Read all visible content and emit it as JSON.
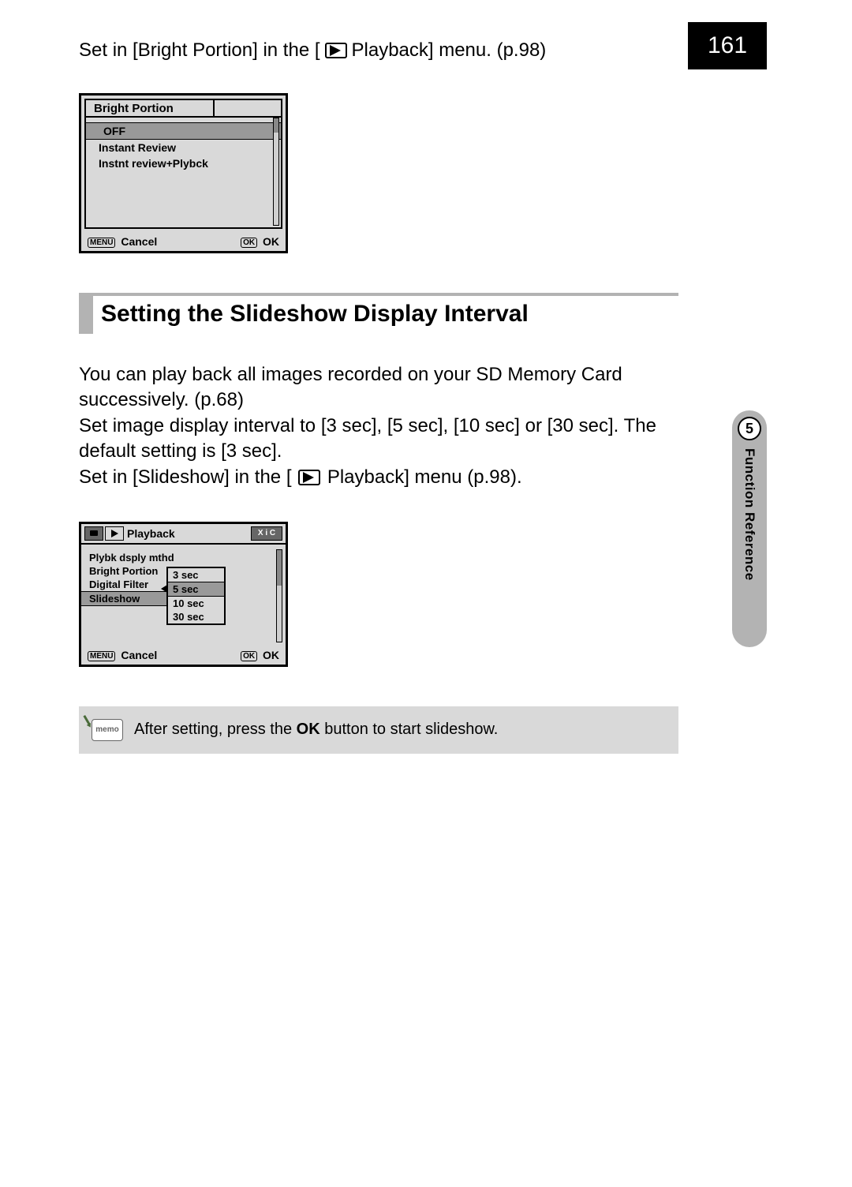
{
  "page_number": "161",
  "side_tab": {
    "number": "5",
    "label": "Function Reference"
  },
  "intro": {
    "before": "Set in [Bright Portion] in the [",
    "after": " Playback] menu. (p.98)"
  },
  "screen1": {
    "tab_title": "Bright Portion",
    "options": [
      "OFF",
      "Instant Review",
      "Instnt review+Plybck"
    ],
    "selected_index": 0,
    "footer_menu_label": "MENU",
    "footer_cancel": " Cancel",
    "footer_ok_icon": "OK",
    "footer_ok": " OK"
  },
  "section_heading": "Setting the Slideshow Display Interval",
  "body": {
    "p1": "You can play back all images recorded on your SD Memory Card successively. (p.68)",
    "p2": "Set image display interval to [3 sec], [5 sec], [10 sec] or [30 sec]. The default setting is [3 sec].",
    "p3_before": "Set in [Slideshow] in the [",
    "p3_after": " Playback] menu (p.98)."
  },
  "screen2": {
    "header_label": "Playback",
    "right_icons": "X i C",
    "menu": [
      "Plybk dsply mthd",
      "Bright Portion",
      "Digital Filter",
      "Slideshow"
    ],
    "menu_selected_index": 3,
    "dropdown": [
      "3 sec",
      "5 sec",
      "10 sec",
      "30 sec"
    ],
    "dropdown_selected_index": 1,
    "footer_menu_label": "MENU",
    "footer_cancel": " Cancel",
    "footer_ok_icon": "OK",
    "footer_ok": " OK"
  },
  "memo": {
    "icon_label": "memo",
    "text_before": "After setting, press the ",
    "ok": "OK",
    "text_after": " button to start slideshow."
  }
}
